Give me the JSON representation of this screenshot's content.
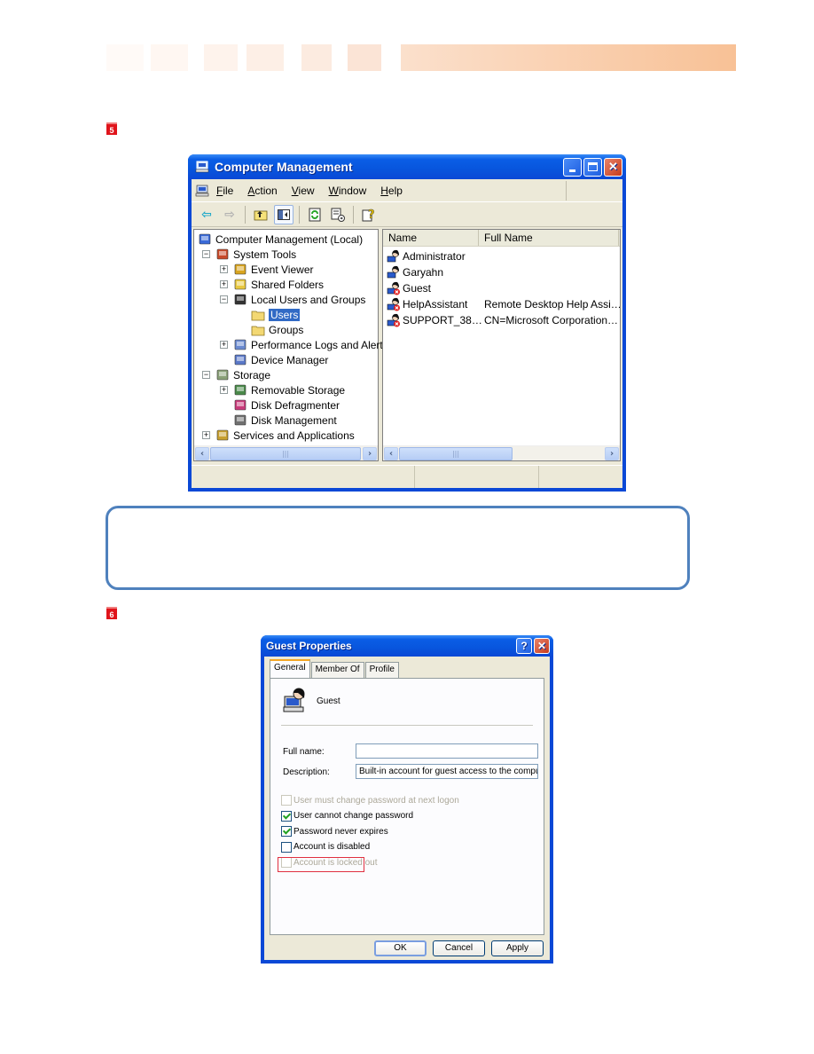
{
  "steps": {
    "step1": "5",
    "step2": "6"
  },
  "computer_management": {
    "title": "Computer Management",
    "menu": [
      "File",
      "Action",
      "View",
      "Window",
      "Help"
    ],
    "menu_accel": [
      "F",
      "A",
      "V",
      "W",
      "H"
    ],
    "toolbar": [
      "back-icon",
      "forward-icon",
      "up-folder-icon",
      "show-hide-tree-icon",
      "refresh-icon",
      "export-list-icon",
      "help-icon"
    ],
    "tree": [
      {
        "label": "Computer Management (Local)",
        "icon": "computer-icon",
        "level": 0
      },
      {
        "label": "System Tools",
        "icon": "system-tools-icon",
        "level": 1,
        "expander": "−"
      },
      {
        "label": "Event Viewer",
        "icon": "event-viewer-icon",
        "level": 2,
        "expander": "+"
      },
      {
        "label": "Shared Folders",
        "icon": "shared-folders-icon",
        "level": 2,
        "expander": "+"
      },
      {
        "label": "Local Users and Groups",
        "icon": "users-groups-icon",
        "level": 2,
        "expander": "−"
      },
      {
        "label": "Users",
        "icon": "folder-open-icon",
        "level": 3,
        "selected": true
      },
      {
        "label": "Groups",
        "icon": "folder-icon",
        "level": 3
      },
      {
        "label": "Performance Logs and Alerts",
        "icon": "performance-icon",
        "level": 2,
        "expander": "+"
      },
      {
        "label": "Device Manager",
        "icon": "device-manager-icon",
        "level": 2
      },
      {
        "label": "Storage",
        "icon": "storage-icon",
        "level": 1,
        "expander": "−"
      },
      {
        "label": "Removable Storage",
        "icon": "removable-storage-icon",
        "level": 2,
        "expander": "+"
      },
      {
        "label": "Disk Defragmenter",
        "icon": "defrag-icon",
        "level": 2
      },
      {
        "label": "Disk Management",
        "icon": "disk-management-icon",
        "level": 2
      },
      {
        "label": "Services and Applications",
        "icon": "services-icon",
        "level": 1,
        "expander": "+"
      }
    ],
    "list_columns": [
      "Name",
      "Full Name"
    ],
    "users": [
      {
        "name": "Administrator",
        "full_name": "",
        "disabled": false
      },
      {
        "name": "Garyahn",
        "full_name": "",
        "disabled": false
      },
      {
        "name": "Guest",
        "full_name": "",
        "disabled": true
      },
      {
        "name": "HelpAssistant",
        "full_name": "Remote Desktop Help Assi…",
        "disabled": true
      },
      {
        "name": "SUPPORT_38…",
        "full_name": "CN=Microsoft Corporation…",
        "disabled": true
      }
    ],
    "scroll_grip": "|||"
  },
  "guest_properties": {
    "title": "Guest Properties",
    "help_btn": "?",
    "close_btn": "✕",
    "tabs": [
      "General",
      "Member Of",
      "Profile"
    ],
    "active_tab": "General",
    "user_name": "Guest",
    "full_name_label": "Full name:",
    "full_name_value": "",
    "description_label": "Description:",
    "description_value": "Built-in account for guest access to the computer/d",
    "checkboxes": [
      {
        "label": "User must change password at next logon",
        "checked": false,
        "disabled": true
      },
      {
        "label": "User cannot change password",
        "checked": true,
        "disabled": false
      },
      {
        "label": "Password never expires",
        "checked": true,
        "disabled": false
      },
      {
        "label": "Account is disabled",
        "checked": false,
        "disabled": false,
        "highlighted": true
      },
      {
        "label": "Account is locked out",
        "checked": false,
        "disabled": true
      }
    ],
    "buttons": {
      "ok": "OK",
      "cancel": "Cancel",
      "apply": "Apply"
    }
  },
  "colors": {
    "xp_blue": "#0a48d6",
    "step_badge": "#e0141b",
    "note_border": "#4f81bd",
    "highlight": "#e03040",
    "banner_end": "#f8c196"
  }
}
